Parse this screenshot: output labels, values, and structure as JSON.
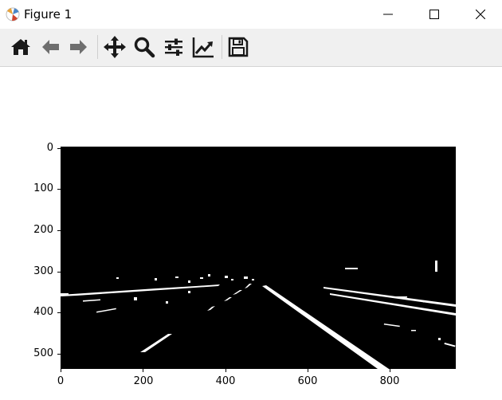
{
  "window": {
    "title": "Figure 1",
    "controls": [
      "minimize",
      "maximize",
      "close"
    ]
  },
  "toolbar": {
    "buttons": [
      {
        "name": "home-icon",
        "tooltip": ""
      },
      {
        "name": "back-arrow-icon",
        "tooltip": ""
      },
      {
        "name": "forward-arrow-icon",
        "tooltip": ""
      },
      {
        "name": "pan-move-icon",
        "tooltip": ""
      },
      {
        "name": "zoom-magnifier-icon",
        "tooltip": ""
      },
      {
        "name": "subplots-config-icon",
        "tooltip": ""
      },
      {
        "name": "edit-axis-curve-icon",
        "tooltip": ""
      },
      {
        "name": "save-floppy-icon",
        "tooltip": ""
      }
    ],
    "colors": {
      "back_forward_disabled": "#6e6e6e",
      "active": "#1a1a1a"
    }
  },
  "plot": {
    "y_ticks": [
      "0",
      "100",
      "200",
      "300",
      "400",
      "500"
    ],
    "x_ticks": [
      "0",
      "200",
      "400",
      "600",
      "800"
    ],
    "background": "#000000",
    "foreground": "#ffffff"
  },
  "chart_data": {
    "type": "image",
    "description_visible": "",
    "x_range": [
      0,
      960
    ],
    "y_range": [
      540,
      0
    ],
    "x_ticks": [
      0,
      200,
      400,
      600,
      800
    ],
    "y_ticks": [
      0,
      100,
      200,
      300,
      400,
      500
    ],
    "grid": false
  }
}
